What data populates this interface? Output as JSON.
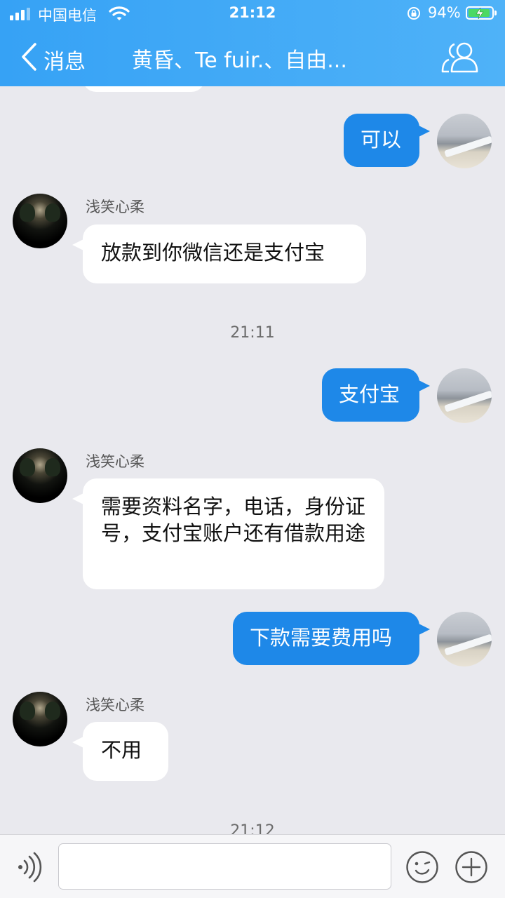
{
  "status_bar": {
    "carrier": "中国电信",
    "time": "21:12",
    "battery_percent": "94%",
    "battery_level": 0.94,
    "icons": [
      "signal-icon",
      "wifi-icon",
      "rotation-lock-icon",
      "battery-charging-icon"
    ]
  },
  "nav": {
    "back_label": "消息",
    "title": "黄昏、Te fuir.、自由...",
    "icons": [
      "back-chevron-icon",
      "group-members-icon"
    ]
  },
  "messages": [
    {
      "side": "out",
      "text": "可以"
    },
    {
      "side": "in",
      "sender": "浅笑心柔",
      "text": "放款到你微信还是支付宝"
    },
    {
      "type": "time",
      "text": "21:11"
    },
    {
      "side": "out",
      "text": "支付宝"
    },
    {
      "side": "in",
      "sender": "浅笑心柔",
      "text": "需要资料名字，电话，身份证号，支付宝账户还有借款用途"
    },
    {
      "side": "out",
      "text": "下款需要费用吗"
    },
    {
      "side": "in",
      "sender": "浅笑心柔",
      "text": "不用"
    },
    {
      "type": "time",
      "text": "21:12"
    }
  ],
  "input_bar": {
    "placeholder": "",
    "icons": [
      "voice-icon",
      "emoji-icon",
      "plus-icon"
    ]
  },
  "colors": {
    "header": "#3ea7f6",
    "outgoing_bubble": "#1e88e8",
    "incoming_bubble": "#ffffff",
    "chat_background": "#e9e9ee"
  }
}
